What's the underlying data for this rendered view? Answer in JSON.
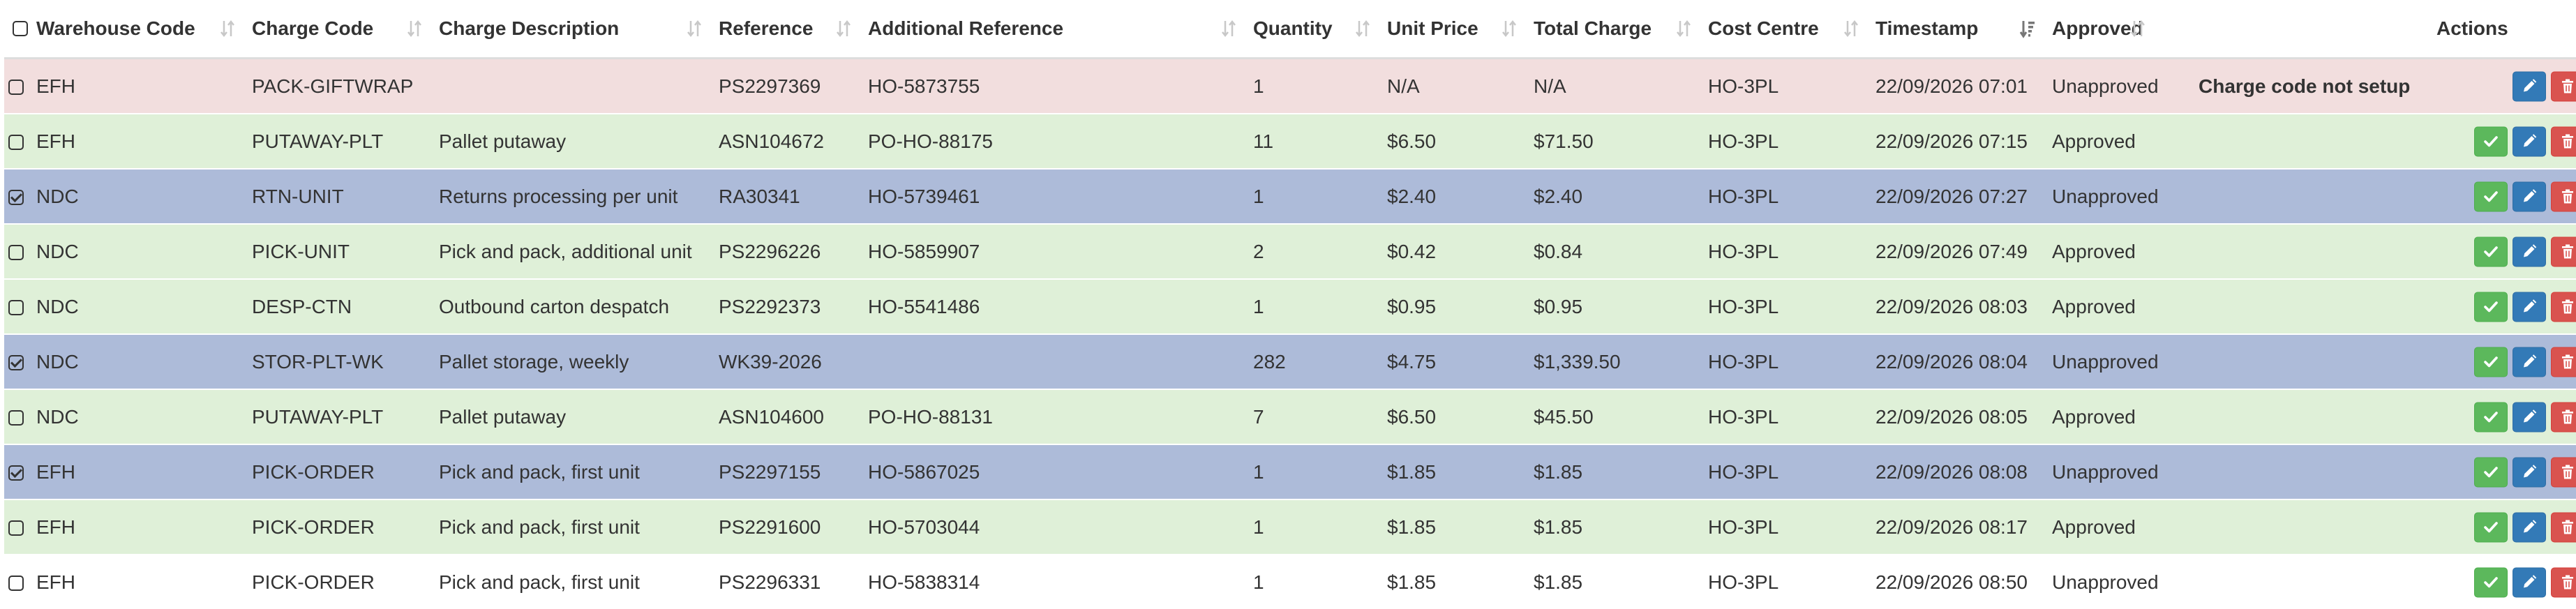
{
  "colors": {
    "row_error": "#f2dede",
    "row_approved": "#dff0d8",
    "row_selected": "#adbbd9",
    "row_plain": "#ffffff",
    "btn_approve": "#5cb85c",
    "btn_edit": "#337ab7",
    "btn_delete": "#d9534f"
  },
  "icons": {
    "sort": "sort-arrows-icon",
    "sort_active": "sort-amount-down-icon",
    "approve": "check-icon",
    "edit": "pencil-icon",
    "delete": "trash-icon"
  },
  "columns": [
    {
      "key": "select",
      "label": ""
    },
    {
      "key": "warehouse_code",
      "label": "Warehouse Code"
    },
    {
      "key": "charge_code",
      "label": "Charge Code"
    },
    {
      "key": "charge_description",
      "label": "Charge Description"
    },
    {
      "key": "reference",
      "label": "Reference"
    },
    {
      "key": "additional_reference",
      "label": "Additional Reference"
    },
    {
      "key": "quantity",
      "label": "Quantity"
    },
    {
      "key": "unit_price",
      "label": "Unit Price"
    },
    {
      "key": "total_charge",
      "label": "Total Charge"
    },
    {
      "key": "cost_centre",
      "label": "Cost Centre"
    },
    {
      "key": "timestamp",
      "label": "Timestamp"
    },
    {
      "key": "approved",
      "label": "Approved"
    },
    {
      "key": "note",
      "label": ""
    },
    {
      "key": "actions",
      "label": "Actions"
    }
  ],
  "sorted_column": "timestamp",
  "rows": [
    {
      "state": "error",
      "checked": false,
      "warehouse_code": "EFH",
      "charge_code": "PACK-GIFTWRAP",
      "charge_description": "",
      "reference": "PS2297369",
      "additional_reference": "HO-5873755",
      "quantity": "1",
      "unit_price": "N/A",
      "total_charge": "N/A",
      "cost_centre": "HO-3PL",
      "timestamp": "22/09/2026 07:01",
      "approved": "Unapproved",
      "note": "Charge code not setup",
      "actions": [
        "edit",
        "delete"
      ]
    },
    {
      "state": "approved",
      "checked": false,
      "warehouse_code": "EFH",
      "charge_code": "PUTAWAY-PLT",
      "charge_description": "Pallet putaway",
      "reference": "ASN104672",
      "additional_reference": "PO-HO-88175",
      "quantity": "11",
      "unit_price": "$6.50",
      "total_charge": "$71.50",
      "cost_centre": "HO-3PL",
      "timestamp": "22/09/2026 07:15",
      "approved": "Approved",
      "note": "",
      "actions": [
        "approve",
        "edit",
        "delete"
      ]
    },
    {
      "state": "selected",
      "checked": true,
      "warehouse_code": "NDC",
      "charge_code": "RTN-UNIT",
      "charge_description": "Returns processing per unit",
      "reference": "RA30341",
      "additional_reference": "HO-5739461",
      "quantity": "1",
      "unit_price": "$2.40",
      "total_charge": "$2.40",
      "cost_centre": "HO-3PL",
      "timestamp": "22/09/2026 07:27",
      "approved": "Unapproved",
      "note": "",
      "actions": [
        "approve",
        "edit",
        "delete"
      ]
    },
    {
      "state": "approved",
      "checked": false,
      "warehouse_code": "NDC",
      "charge_code": "PICK-UNIT",
      "charge_description": "Pick and pack, additional unit",
      "reference": "PS2296226",
      "additional_reference": "HO-5859907",
      "quantity": "2",
      "unit_price": "$0.42",
      "total_charge": "$0.84",
      "cost_centre": "HO-3PL",
      "timestamp": "22/09/2026 07:49",
      "approved": "Approved",
      "note": "",
      "actions": [
        "approve",
        "edit",
        "delete"
      ]
    },
    {
      "state": "approved",
      "checked": false,
      "warehouse_code": "NDC",
      "charge_code": "DESP-CTN",
      "charge_description": "Outbound carton despatch",
      "reference": "PS2292373",
      "additional_reference": "HO-5541486",
      "quantity": "1",
      "unit_price": "$0.95",
      "total_charge": "$0.95",
      "cost_centre": "HO-3PL",
      "timestamp": "22/09/2026 08:03",
      "approved": "Approved",
      "note": "",
      "actions": [
        "approve",
        "edit",
        "delete"
      ]
    },
    {
      "state": "selected",
      "checked": true,
      "warehouse_code": "NDC",
      "charge_code": "STOR-PLT-WK",
      "charge_description": "Pallet storage, weekly",
      "reference": "WK39-2026",
      "additional_reference": "",
      "quantity": "282",
      "unit_price": "$4.75",
      "total_charge": "$1,339.50",
      "cost_centre": "HO-3PL",
      "timestamp": "22/09/2026 08:04",
      "approved": "Unapproved",
      "note": "",
      "actions": [
        "approve",
        "edit",
        "delete"
      ]
    },
    {
      "state": "approved",
      "checked": false,
      "warehouse_code": "NDC",
      "charge_code": "PUTAWAY-PLT",
      "charge_description": "Pallet putaway",
      "reference": "ASN104600",
      "additional_reference": "PO-HO-88131",
      "quantity": "7",
      "unit_price": "$6.50",
      "total_charge": "$45.50",
      "cost_centre": "HO-3PL",
      "timestamp": "22/09/2026 08:05",
      "approved": "Approved",
      "note": "",
      "actions": [
        "approve",
        "edit",
        "delete"
      ]
    },
    {
      "state": "selected",
      "checked": true,
      "warehouse_code": "EFH",
      "charge_code": "PICK-ORDER",
      "charge_description": "Pick and pack, first unit",
      "reference": "PS2297155",
      "additional_reference": "HO-5867025",
      "quantity": "1",
      "unit_price": "$1.85",
      "total_charge": "$1.85",
      "cost_centre": "HO-3PL",
      "timestamp": "22/09/2026 08:08",
      "approved": "Unapproved",
      "note": "",
      "actions": [
        "approve",
        "edit",
        "delete"
      ]
    },
    {
      "state": "approved",
      "checked": false,
      "warehouse_code": "EFH",
      "charge_code": "PICK-ORDER",
      "charge_description": "Pick and pack, first unit",
      "reference": "PS2291600",
      "additional_reference": "HO-5703044",
      "quantity": "1",
      "unit_price": "$1.85",
      "total_charge": "$1.85",
      "cost_centre": "HO-3PL",
      "timestamp": "22/09/2026 08:17",
      "approved": "Approved",
      "note": "",
      "actions": [
        "approve",
        "edit",
        "delete"
      ]
    },
    {
      "state": "plain",
      "checked": false,
      "warehouse_code": "EFH",
      "charge_code": "PICK-ORDER",
      "charge_description": "Pick and pack, first unit",
      "reference": "PS2296331",
      "additional_reference": "HO-5838314",
      "quantity": "1",
      "unit_price": "$1.85",
      "total_charge": "$1.85",
      "cost_centre": "HO-3PL",
      "timestamp": "22/09/2026 08:50",
      "approved": "Unapproved",
      "note": "",
      "actions": [
        "approve",
        "edit",
        "delete"
      ]
    }
  ]
}
